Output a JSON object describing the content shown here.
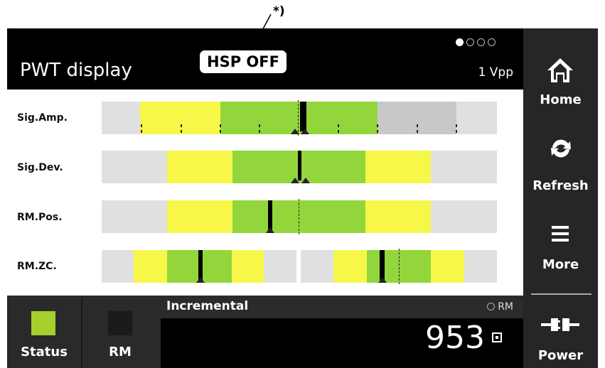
{
  "annotation": "*)",
  "header": {
    "title": "PWT display",
    "hsp_badge": "HSP OFF",
    "signal_type": "1 Vpp",
    "page_indicator": {
      "count": 4,
      "active": 1
    }
  },
  "rows": [
    {
      "label": "Sig.Amp."
    },
    {
      "label": "Sig.Dev."
    },
    {
      "label": "RM.Pos."
    },
    {
      "label": "RM.ZC."
    }
  ],
  "sidebar": {
    "home": "Home",
    "refresh": "Refresh",
    "more": "More",
    "power": "Power"
  },
  "bottom": {
    "status": "Status",
    "rm": "RM",
    "status_color": "#a5cf2c",
    "rm_color": "#1a1a1a"
  },
  "counter": {
    "mode": "Incremental",
    "rm_indicator": "RM",
    "value": "953"
  },
  "colors": {
    "yellow_zone": "#f7f74a",
    "green_zone": "#93d63c",
    "grey_zone": "#c8c8c8"
  }
}
